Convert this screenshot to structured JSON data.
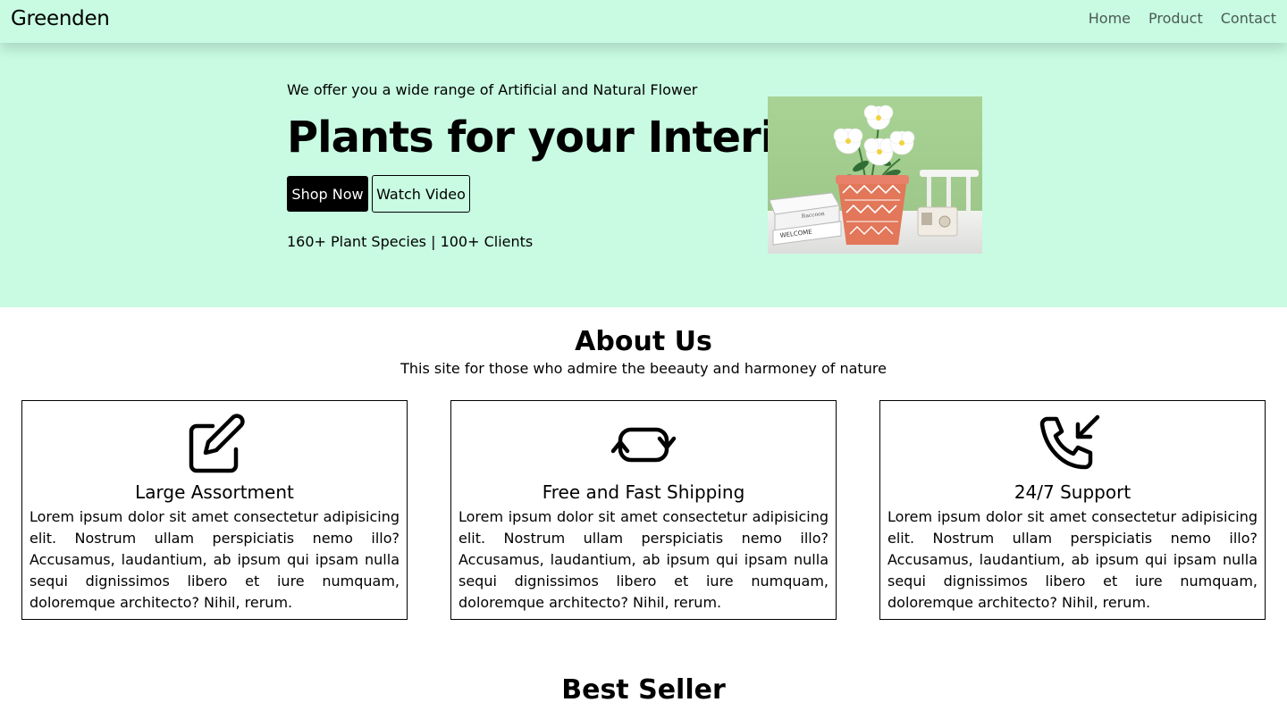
{
  "nav": {
    "brand": "Greenden",
    "links": [
      "Home",
      "Product",
      "Contact"
    ]
  },
  "hero": {
    "tagline": "We offer you a wide range of Artificial and Natural Flower",
    "title": "Plants for your Interiour",
    "buttons": {
      "shop": "Shop Now",
      "watch": "Watch Video"
    },
    "stats": "160+ Plant Species | 100+ Clients",
    "image_icon": "potted-flower-photo"
  },
  "about": {
    "title": "About Us",
    "subtitle": "This site for those who admire the beeauty and harmoney of nature",
    "cards": [
      {
        "icon": "edit-icon",
        "title": "Large Assortment",
        "text": "Lorem ipsum dolor sit amet consectetur adipisicing elit. Nostrum ullam perspiciatis nemo illo? Accusamus, laudantium, ab ipsum qui ipsam nulla sequi dignissimos libero et iure numquam, doloremque architecto? Nihil, rerum."
      },
      {
        "icon": "sync-icon",
        "title": "Free and Fast Shipping",
        "text": "Lorem ipsum dolor sit amet consectetur adipisicing elit. Nostrum ullam perspiciatis nemo illo? Accusamus, laudantium, ab ipsum qui ipsam nulla sequi dignissimos libero et iure numquam, doloremque architecto? Nihil, rerum."
      },
      {
        "icon": "phone-incoming-icon",
        "title": "24/7 Support",
        "text": "Lorem ipsum dolor sit amet consectetur adipisicing elit. Nostrum ullam perspiciatis nemo illo? Accusamus, laudantium, ab ipsum qui ipsam nulla sequi dignissimos libero et iure numquam, doloremque architecto? Nihil, rerum."
      }
    ]
  },
  "best_seller": {
    "title": "Best Seller"
  },
  "colors": {
    "mint": "#c8fbe2",
    "pot": "#e2775a",
    "wall": "#a6cf8f"
  }
}
